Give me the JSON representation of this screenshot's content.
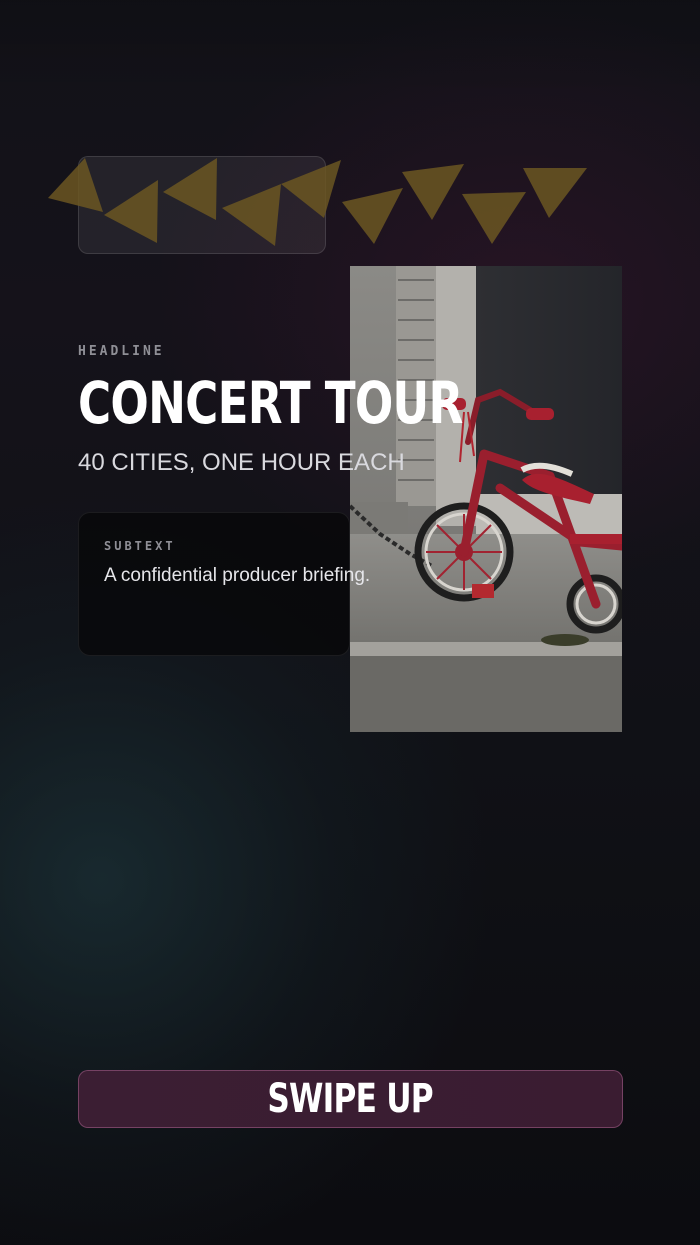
{
  "story": {
    "kicker": "HEADLINE",
    "headline": "CONCERT TOUR",
    "subheadline": "40 CITIES, ONE HOUR EACH",
    "subtext_label": "SUBTEXT",
    "subtext": "A confidential producer briefing.",
    "cta_label": "SWIPE UP"
  },
  "photo": {
    "subject": "red tricycle chained on a sidewalk"
  },
  "colors": {
    "background": "#121218",
    "bunting": "#6b5622",
    "cta_background": "#3b1e33",
    "cta_border": "#b46e9a",
    "tricycle_red": "#9a1f2e"
  }
}
